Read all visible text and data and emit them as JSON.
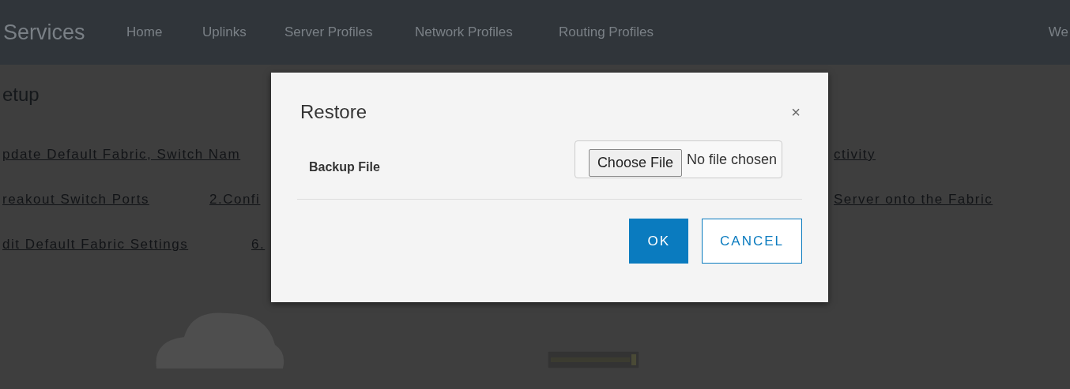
{
  "navbar": {
    "brand": "Services",
    "items": [
      "Home",
      "Uplinks",
      "Server Profiles",
      "Network Profiles",
      "Routing Profiles"
    ],
    "right_text": "We"
  },
  "page": {
    "title": "etup",
    "link_rows": [
      [
        "pdate Default Fabric, Switch Nam",
        "ctivity"
      ],
      [
        "reakout Switch Ports",
        "2.Confi",
        "Server onto the Fabric"
      ],
      [
        "dit Default Fabric Settings",
        "6."
      ]
    ]
  },
  "dialog": {
    "title": "Restore",
    "close": "×",
    "field": {
      "label": "Backup File",
      "button": "Choose File",
      "status": "No file chosen"
    },
    "buttons": [
      {
        "label": "OK",
        "kind": "primary"
      },
      {
        "label": "CANCEL",
        "kind": "secondary"
      }
    ]
  }
}
